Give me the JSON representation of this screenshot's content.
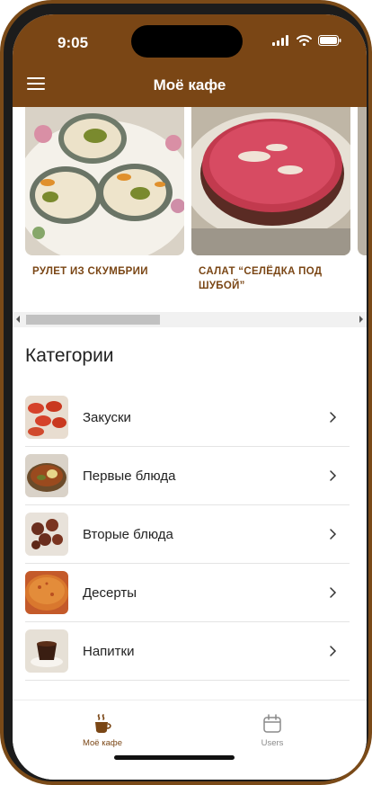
{
  "status": {
    "time": "9:05"
  },
  "header": {
    "title": "Моё кафе"
  },
  "carousel": {
    "items": [
      {
        "title": "РУЛЕТ ИЗ СКУМБРИИ"
      },
      {
        "title": "САЛАТ “СЕЛЁДКА ПОД ШУБОЙ”"
      }
    ]
  },
  "categories": {
    "heading": "Категории",
    "items": [
      {
        "label": "Закуски"
      },
      {
        "label": "Первые блюда"
      },
      {
        "label": "Вторые блюда"
      },
      {
        "label": "Десерты"
      },
      {
        "label": "Напитки"
      }
    ]
  },
  "bottom_nav": {
    "items": [
      {
        "label": "Моё кафе",
        "icon": "coffee-cup-icon",
        "active": true
      },
      {
        "label": "Users",
        "icon": "calendar-icon",
        "active": false
      }
    ]
  },
  "colors": {
    "brand": "#7a4615",
    "inactive": "#8a8a8a"
  }
}
